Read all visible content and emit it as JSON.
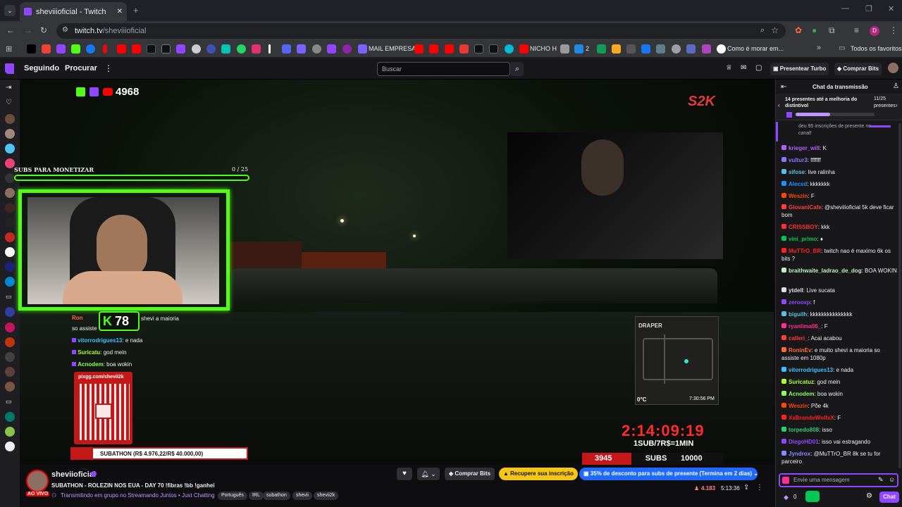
{
  "browser": {
    "tab_title": "sheviiioficial - Twitch",
    "url_domain": "twitch.tv",
    "url_path": "/sheviiioficial",
    "profile_initial": "D",
    "bookmarks": {
      "mail": "MAIL EMPRESA",
      "nicho": "NICHO H",
      "num": "2",
      "como": "Como é morar em...",
      "all": "Todos os favoritos"
    }
  },
  "nav": {
    "following": "Seguindo",
    "browse": "Procurar",
    "search_placeholder": "Buscar",
    "turbo": "Presentear Turbo",
    "bits": "Comprar Bits"
  },
  "overlay": {
    "viewer_count": "4968",
    "subs_label": "SUBS PARA MONETIZAR",
    "subs_progress": "0 / 25",
    "k_count": "78",
    "pix_url": "pixgg.com/shevii2k",
    "subathon": "SUBATHON (R$ 4.976,22/R$ 40.000,00)",
    "timer": "2:14:09:19",
    "rate": "1SUB/7R$=1MIN",
    "subs_current": "3945",
    "subs_word": "SUBS",
    "subs_goal": "10000",
    "map_label": "DRAPER",
    "temp": "0°C",
    "clock": "7:30:56 PM",
    "chat_lines": [
      {
        "user": "Ron",
        "msg": "shevi a maioria"
      },
      {
        "user": "",
        "msg": "so assiste"
      },
      {
        "user": "vitorrodrigues13",
        "msg": ": e nada"
      },
      {
        "user": "Suricatu",
        "msg": ": god mein"
      },
      {
        "user": "Acnodem",
        "msg": ": boa wokin"
      }
    ]
  },
  "stream": {
    "channel": "sheviioficial",
    "live": "AO VIVO",
    "title": "SUBATHON - ROLEZIN NOS EUA - DAY 70 !fibras !bb !ganhei",
    "group": "Transmitindo em grupo no Streamando Juntos",
    "category": "Just Chatting",
    "tags": [
      "Português",
      "IRL",
      "subathon",
      "shevii",
      "shevii2k"
    ],
    "buy_bits": "Comprar Bits",
    "recover": "Recupere sua inscrição",
    "discount": "35% de desconto para subs de presente (Termina em 2 dias)",
    "viewers": "4.183",
    "uptime": "5:13:36"
  },
  "chat": {
    "header": "Chat da transmissão",
    "gift_title": "14 presentes até a melhoria do distintivol",
    "gift_count": "11/25",
    "gift_word": "presentes",
    "pinned": "deu 95 inscrições de presente no canal!",
    "input_placeholder": "Envie uma mensagem",
    "bits_count": "0",
    "send": "Chat",
    "messages": [
      {
        "user": "krieger_will",
        "color": "#b75cff",
        "msg": ": K"
      },
      {
        "user": "vultur3",
        "color": "#8a75ff",
        "msg": ": fffffff"
      },
      {
        "user": "sifose",
        "color": "#5bc0de",
        "msg": ": live ralinha"
      },
      {
        "user": "Alecxd",
        "color": "#1e90ff",
        "msg": ": kkkkkkk"
      },
      {
        "user": "Weszin",
        "color": "#ff4500",
        "msg": ": F"
      },
      {
        "user": "GiovaniCafe",
        "color": "#ff4040",
        "msg": ": @sheviiioficial 5k deve ficar bom"
      },
      {
        "user": "CRISSBOY",
        "color": "#ff3030",
        "msg": ": kkk"
      },
      {
        "user": "vini_primo",
        "color": "#00c853",
        "msg": ": ♦"
      },
      {
        "user": "MuTTrO_BR",
        "color": "#ff2020",
        "msg": ": twitch nao é maximo 6k os bits ?"
      },
      {
        "user": "braithwaite_ladrao_de_dog",
        "color": "#c0f0c0",
        "msg": ": BOA WOKIN"
      },
      {
        "user": "ytdell",
        "color": "#dedee3",
        "msg": ": Live sucata"
      },
      {
        "user": "zerooxp",
        "color": "#9147ff",
        "msg": ": f"
      },
      {
        "user": "biguilh",
        "color": "#5bc0de",
        "msg": ": kkkkkkkkkkkkkkk"
      },
      {
        "user": "ryanlima06_",
        "color": "#ff2d95",
        "msg": ": F"
      },
      {
        "user": "calleri_",
        "color": "#ff3c3c",
        "msg": ": Acai acabou"
      },
      {
        "user": "RoninEv",
        "color": "#ff6b35",
        "msg": ": e muito shevi a maioria so assiste em 1080p"
      },
      {
        "user": "vitorrodrigues13",
        "color": "#40c0ff",
        "msg": ": e nada"
      },
      {
        "user": "Suricatuz",
        "color": "#adff2f",
        "msg": ": god mein"
      },
      {
        "user": "Acnodem",
        "color": "#8aff5a",
        "msg": ": boa wokin"
      },
      {
        "user": "Weszin",
        "color": "#ff4500",
        "msg": ": Põe 4k"
      },
      {
        "user": "XxBrandoWolfxX",
        "color": "#ff2020",
        "msg": ": F"
      },
      {
        "user": "torpedo808",
        "color": "#2ecc71",
        "msg": ": isso"
      },
      {
        "user": "DiegoHD01",
        "color": "#9147ff",
        "msg": ": isso vai estragando"
      },
      {
        "user": "Jyndrox",
        "color": "#8a8aff",
        "msg": ": @MuTTrO_BR 8k se tu for parceiro"
      }
    ]
  }
}
